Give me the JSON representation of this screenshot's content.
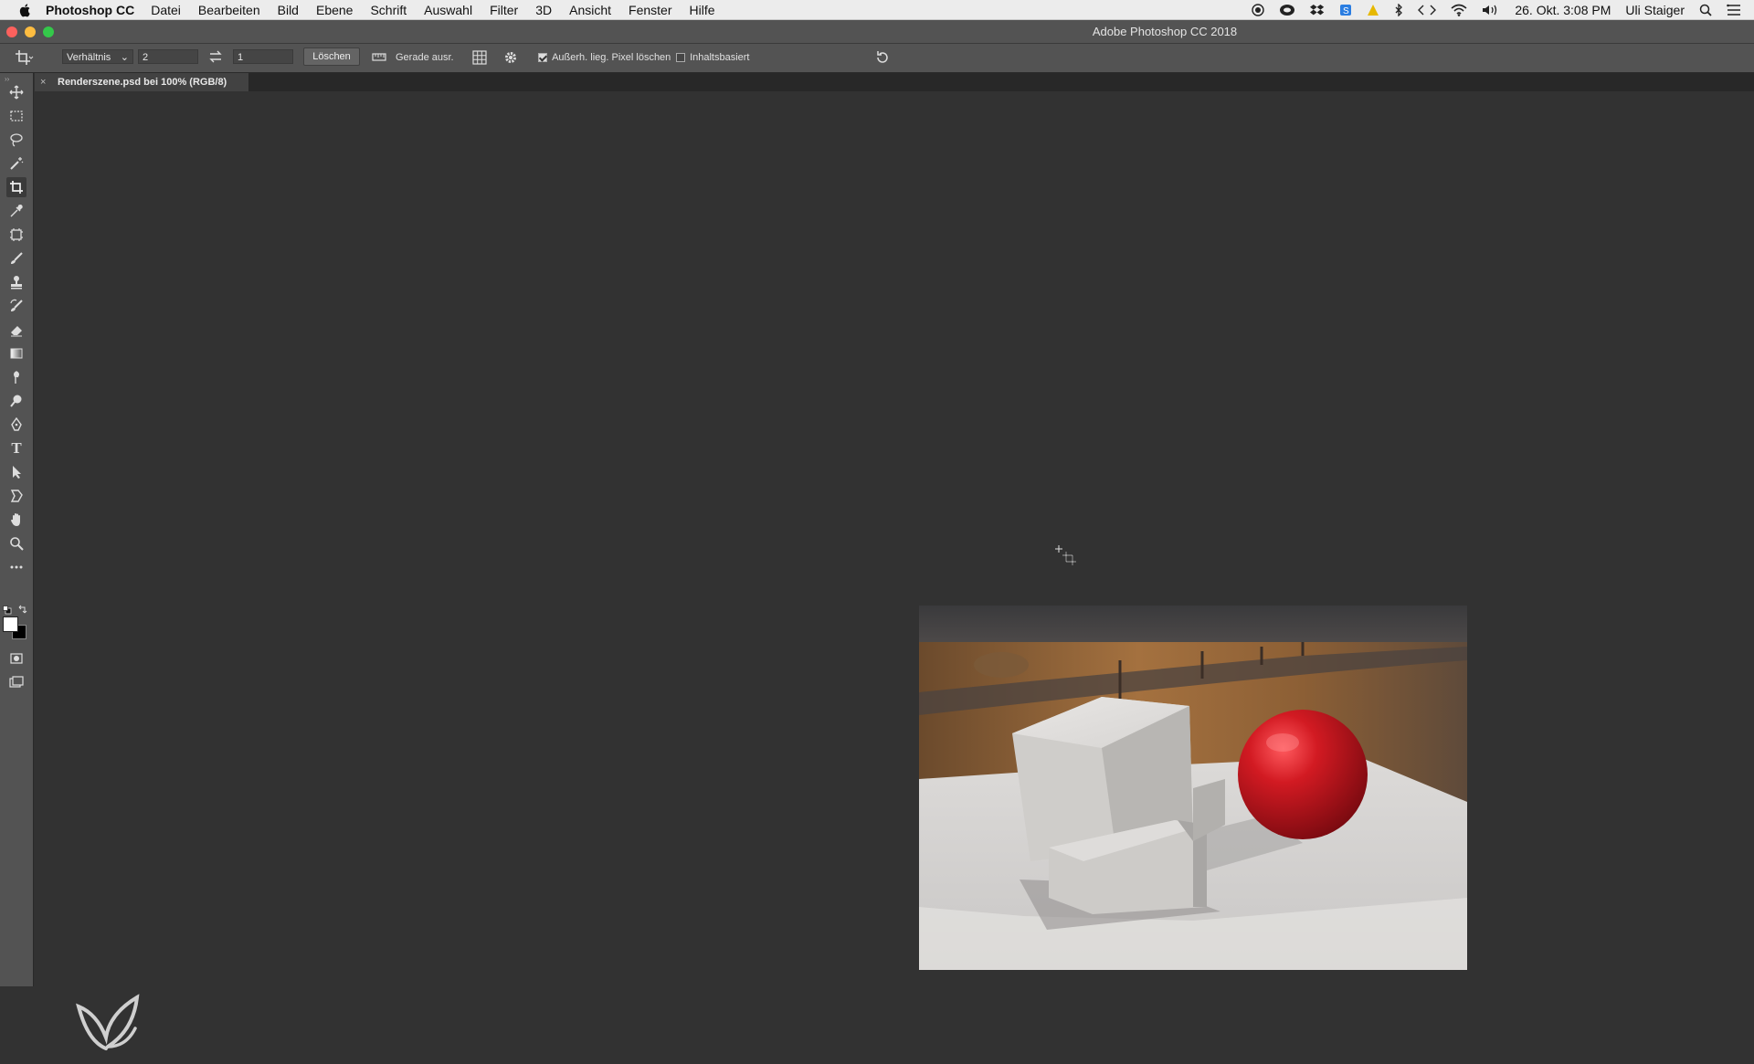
{
  "menubar": {
    "app_name": "Photoshop CC",
    "menus": [
      "Datei",
      "Bearbeiten",
      "Bild",
      "Ebene",
      "Schrift",
      "Auswahl",
      "Filter",
      "3D",
      "Ansicht",
      "Fenster",
      "Hilfe"
    ],
    "clock": "26. Okt.  3:08 PM",
    "user": "Uli Staiger"
  },
  "window": {
    "title": "Adobe Photoshop CC 2018"
  },
  "options_bar": {
    "ratio_select": "Verhältnis",
    "width_value": "2",
    "height_value": "1",
    "clear_button": "Löschen",
    "straighten_label": "Gerade ausr.",
    "delete_pixels_label": "Außerh. lieg. Pixel löschen",
    "delete_pixels_checked": true,
    "content_aware_label": "Inhaltsbasiert",
    "content_aware_checked": false
  },
  "document_tab": {
    "close_glyph": "×",
    "title": "Renderszene.psd bei 100% (RGB/8)"
  },
  "tools": [
    "move-tool",
    "marquee-tool",
    "lasso-tool",
    "magic-wand-tool",
    "crop-tool",
    "eyedropper-tool",
    "frame-tool",
    "brush-tool",
    "stamp-tool",
    "history-brush-tool",
    "eraser-tool",
    "gradient-tool",
    "smudge-tool",
    "dodge-tool",
    "pen-tool",
    "type-tool",
    "path-selection-tool",
    "custom-shape-tool",
    "hand-tool",
    "zoom-tool",
    "more-tools"
  ],
  "type_tool_glyph": "T",
  "colors": {
    "foreground": "#ffffff",
    "background": "#000000",
    "accent_red_ball": "#d21a22"
  }
}
